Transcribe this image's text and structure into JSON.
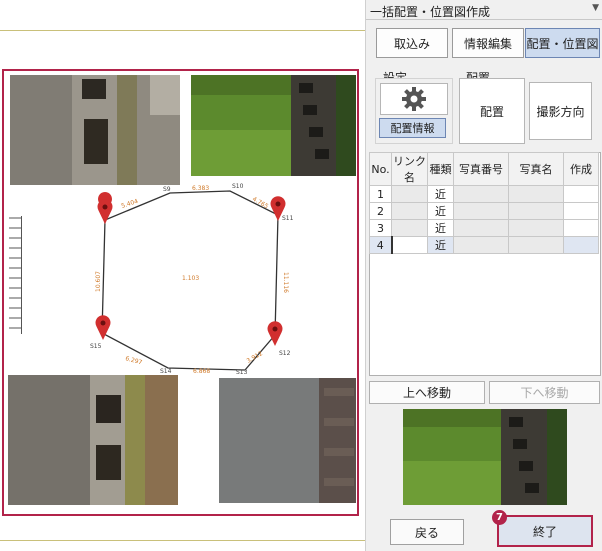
{
  "panel": {
    "title": "一括配置・位置図作成",
    "tabs": [
      "取込み",
      "情報編集",
      "配置・位置図"
    ],
    "settings_label": "設定",
    "placement_label": "配置",
    "placement_info_button": "配置情報",
    "place_button": "配置",
    "shooting_direction_button": "撮影方向"
  },
  "table": {
    "headers": [
      "No.",
      "リンク名",
      "種類",
      "写真番号",
      "写真名",
      "作成"
    ],
    "rows": [
      {
        "no": "1",
        "type": "近"
      },
      {
        "no": "2",
        "type": "近"
      },
      {
        "no": "3",
        "type": "近"
      },
      {
        "no": "4",
        "type": "近"
      }
    ]
  },
  "buttons": {
    "move_up": "上へ移動",
    "move_down": "下へ移動",
    "back": "戻る",
    "finish": "終了"
  },
  "step_badge": "7",
  "diagram": {
    "station_labels": [
      "S9",
      "S10",
      "S11",
      "S12",
      "S13",
      "S14",
      "S15"
    ],
    "dimension_labels": [
      "5.404",
      "6.383",
      "4.765",
      "10.607",
      "11.116",
      "6.297",
      "6.868",
      "3.912"
    ],
    "area_label": "1.103"
  },
  "colors": {
    "highlight": "#b2234a",
    "active_tab": "#cddbef",
    "dimension_text": "#d07a2a",
    "marker": "#d12f2f"
  }
}
